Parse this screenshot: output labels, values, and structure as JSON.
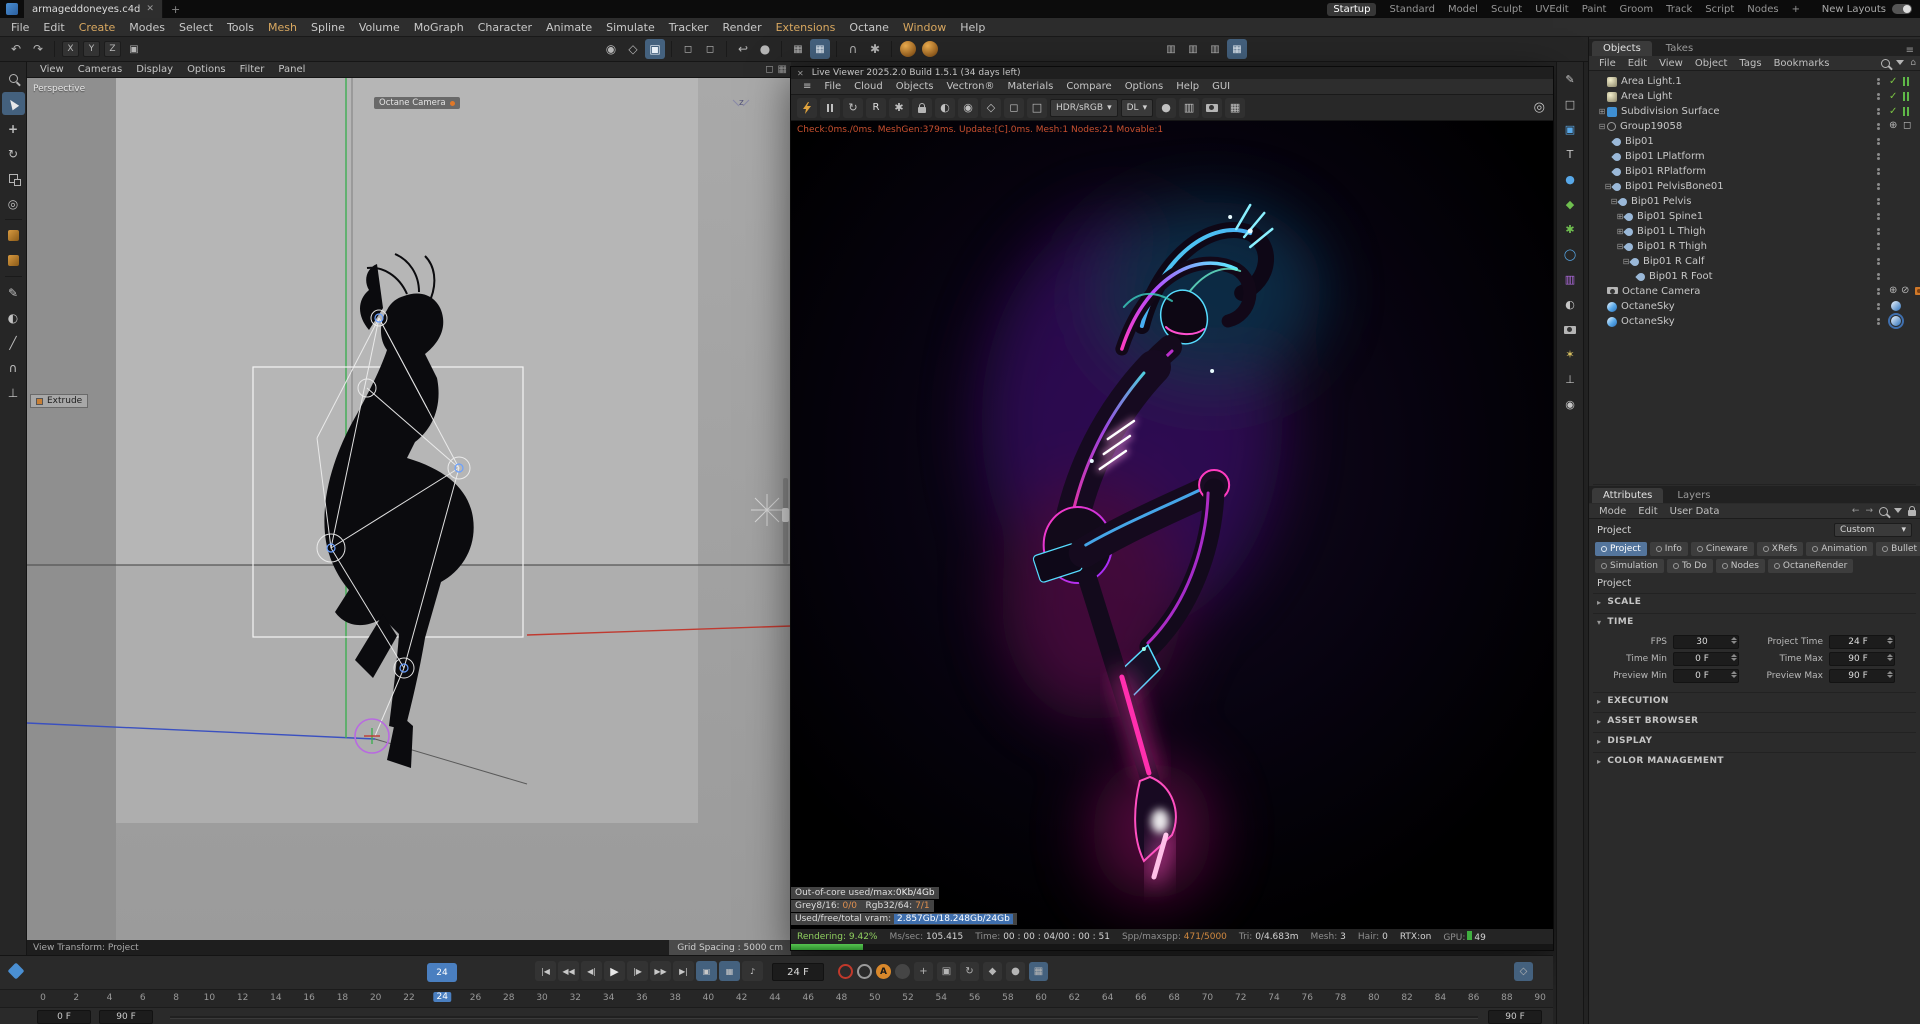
{
  "icons": {
    "close": "✕",
    "add": "+",
    "menu": "≡",
    "undo": "↶",
    "redo": "↷",
    "caret_right": "▸",
    "caret_down": "▾",
    "dropdown": "▾",
    "expand": "⊞",
    "collapse": "⊟",
    "check": "✓",
    "target": "◎",
    "disabled": "⊘",
    "crosshair": "⊕",
    "goto_start": "|◀",
    "prev_key": "◀◀",
    "prev_frame": "◀|",
    "play": "▶",
    "next_frame": "|▶",
    "next_key": "▶▶",
    "goto_end": "▶|",
    "sound": "♪",
    "autokey": "A",
    "rotate": "↻",
    "gear": "✱",
    "pen": "✎",
    "knife": "╱",
    "magnet": "∩",
    "move": "+",
    "circle": "●",
    "ring": "◯",
    "sphere": "◐",
    "grid": "▦",
    "square": "□",
    "fsquare": "▣",
    "wsquare": "◻",
    "diamond": "◆",
    "odiamond": "◇",
    "star": "✶",
    "uturn": "↩",
    "tee": "⊥",
    "letter_t": "T",
    "home": "⌂",
    "simulate": "◉",
    "left": "←",
    "right": "→",
    "halfsq": "▥"
  },
  "window": {
    "tab_title": "armageddoneyes.c4d",
    "layouts": [
      "Startup",
      "Standard",
      "Model",
      "Sculpt",
      "UVEdit",
      "Paint",
      "Groom",
      "Track",
      "Script",
      "Nodes"
    ],
    "new_layouts_label": "New Layouts"
  },
  "menubar": {
    "items": [
      "File",
      "Edit",
      "Create",
      "Modes",
      "Select",
      "Tools",
      "Mesh",
      "Spline",
      "Volume",
      "MoGraph",
      "Character",
      "Animate",
      "Simulate",
      "Tracker",
      "Render",
      "Extensions",
      "Octane",
      "Window",
      "Help"
    ]
  },
  "toolbar": {
    "axis": [
      "X",
      "Y",
      "Z"
    ]
  },
  "viewport": {
    "menu": [
      "View",
      "Cameras",
      "Display",
      "Options",
      "Filter",
      "Panel"
    ],
    "view_label": "Perspective",
    "camera_tag": "Octane Camera",
    "tool_hud": "Extrude",
    "axis_hud": "z",
    "footer_left": "View Transform: Project",
    "footer_right": "Grid Spacing : 5000 cm"
  },
  "live_viewer": {
    "title": "Live Viewer 2025.2.0 Build 1.5.1 (34 days left)",
    "menu": [
      "File",
      "Cloud",
      "Objects",
      "Vectron®",
      "Materials",
      "Compare",
      "Options",
      "Help",
      "GUI"
    ],
    "region_button": "R",
    "colorspace": "HDR/sRGB",
    "sampling_mode": "DL",
    "status_line": "Check:0ms./0ms. MeshGen:379ms. Update:[C].0ms. Mesh:1 Nodes:21 Movable:1",
    "overlay": {
      "out_of_core_label": "Out-of-core used/max:",
      "out_of_core_value": "0Kb/4Gb",
      "grey_label": "Grey8/16:",
      "grey_value": "0/0",
      "rgb_label": "Rgb32/64:",
      "rgb_value": "7/1",
      "vram_label": "Used/free/total vram:",
      "vram_value": "2.857Gb/18.248Gb/24Gb"
    },
    "stats": {
      "rendering_label": "Rendering:",
      "rendering_value": "9.42%",
      "mssec_label": "Ms/sec:",
      "mssec_value": "105.415",
      "time_label": "Time:",
      "time_value": "00 : 00 : 04/00 : 00 : 51",
      "spp_label": "Spp/maxspp:",
      "spp_value": "471/5000",
      "tri_label": "Tri:",
      "tri_value": "0/4.683m",
      "mesh_label": "Mesh:",
      "mesh_value": "3",
      "hair_label": "Hair:",
      "hair_value": "0",
      "rtx_label": "RTX:on",
      "gpu_label": "GPU:",
      "gpu_value": "49"
    },
    "progress_percent": 9.42
  },
  "objects_panel": {
    "tabs": [
      "Objects",
      "Takes"
    ],
    "menu": [
      "File",
      "Edit",
      "View",
      "Object",
      "Tags",
      "Bookmarks"
    ],
    "tree": [
      {
        "label": "Area Light.1"
      },
      {
        "label": "Area Light"
      },
      {
        "label": "Subdivision Surface"
      },
      {
        "label": "Group19058"
      },
      {
        "label": "Bip01"
      },
      {
        "label": "Bip01 LPlatform"
      },
      {
        "label": "Bip01 RPlatform"
      },
      {
        "label": "Bip01 PelvisBone01"
      },
      {
        "label": "Bip01 Pelvis"
      },
      {
        "label": "Bip01 Spine1"
      },
      {
        "label": "Bip01 L Thigh"
      },
      {
        "label": "Bip01 R Thigh"
      },
      {
        "label": "Bip01 R Calf"
      },
      {
        "label": "Bip01 R Foot"
      },
      {
        "label": "Octane Camera"
      },
      {
        "label": "OctaneSky"
      },
      {
        "label": "OctaneSky"
      }
    ]
  },
  "attributes_panel": {
    "tabs": [
      "Attributes",
      "Layers"
    ],
    "menu": [
      "Mode",
      "Edit",
      "User Data"
    ],
    "object_title": "Project",
    "preset_value": "Custom",
    "category_tabs": [
      "Project",
      "Info",
      "Cineware",
      "XRefs",
      "Animation",
      "Bullet",
      "Simulation",
      "To Do",
      "Nodes",
      "OctaneRender"
    ],
    "section_title": "Project",
    "sections": [
      "SCALE",
      "TIME",
      "EXECUTION",
      "ASSET BROWSER",
      "DISPLAY",
      "COLOR MANAGEMENT"
    ],
    "time": {
      "fps_label": "FPS",
      "fps_value": "30",
      "project_time_label": "Project Time",
      "project_time_value": "24 F",
      "time_min_label": "Time Min",
      "time_min_value": "0 F",
      "time_max_label": "Time Max",
      "time_max_value": "90 F",
      "preview_min_label": "Preview Min",
      "preview_min_value": "0 F",
      "preview_max_label": "Preview Max",
      "preview_max_value": "90 F"
    }
  },
  "timeline": {
    "frame_value": "24 F",
    "knob_label": "24",
    "current_frame": "24",
    "ruler": [
      "0",
      "2",
      "4",
      "6",
      "8",
      "10",
      "12",
      "14",
      "16",
      "18",
      "20",
      "22",
      "24",
      "26",
      "28",
      "30",
      "32",
      "34",
      "36",
      "38",
      "40",
      "42",
      "44",
      "46",
      "48",
      "50",
      "52",
      "54",
      "56",
      "58",
      "60",
      "62",
      "64",
      "66",
      "68",
      "70",
      "72",
      "74",
      "76",
      "78",
      "80",
      "82",
      "84",
      "86",
      "88",
      "90"
    ],
    "range_start": "0 F",
    "range_end": "90 F",
    "range_end_right": "90 F"
  }
}
